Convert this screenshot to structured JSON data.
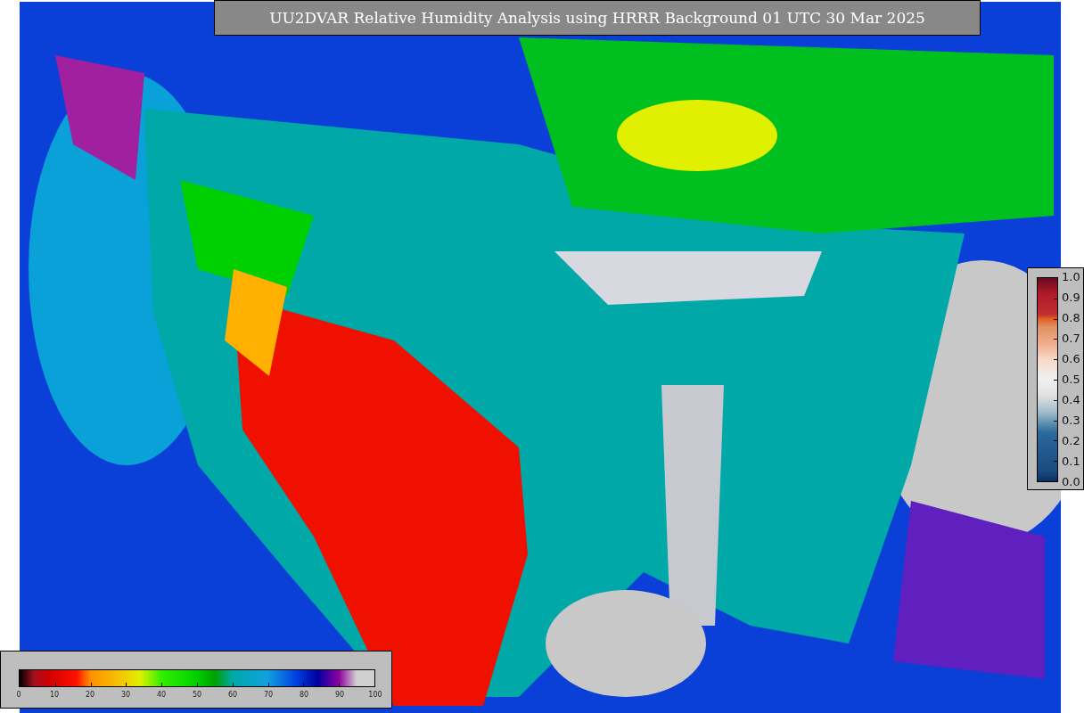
{
  "title": "UU2DVAR Relative Humidity Analysis using HRRR Background 01 UTC 30 Mar 2025",
  "bottom_colorbar": {
    "ticks": [
      "0",
      "10",
      "20",
      "30",
      "40",
      "50",
      "60",
      "70",
      "80",
      "90",
      "100"
    ]
  },
  "right_colorbar": {
    "ticks": [
      "1.0",
      "0.9",
      "0.8",
      "0.7",
      "0.6",
      "0.5",
      "0.4",
      "0.3",
      "0.2",
      "0.1",
      "0.0"
    ]
  }
}
